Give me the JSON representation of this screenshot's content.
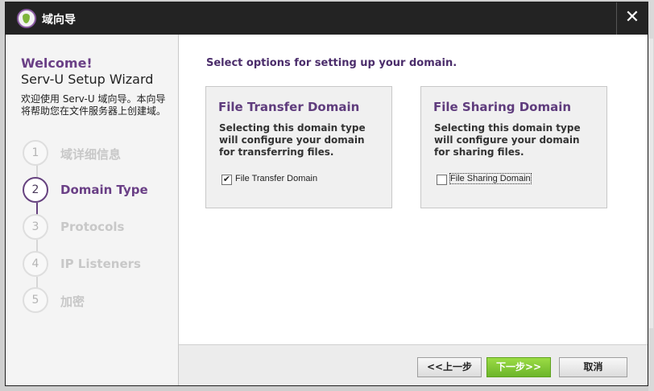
{
  "window": {
    "title": "域向导",
    "close_glyph": "✕"
  },
  "sidebar": {
    "welcome": "Welcome!",
    "subtitle": "Serv-U Setup Wizard",
    "description": "欢迎使用 Serv-U 域向导。本向导将帮助您在文件服务器上创建域。",
    "steps": [
      {
        "number": "1",
        "label": "域详细信息",
        "state": "done"
      },
      {
        "number": "2",
        "label": "Domain Type",
        "state": "active"
      },
      {
        "number": "3",
        "label": "Protocols",
        "state": "pending"
      },
      {
        "number": "4",
        "label": "IP Listeners",
        "state": "pending"
      },
      {
        "number": "5",
        "label": "加密",
        "state": "pending"
      }
    ]
  },
  "main": {
    "headline": "Select options for setting up your domain.",
    "cards": [
      {
        "title": "File Transfer Domain",
        "text": "Selecting this domain type will configure your domain for transferring files.",
        "checkbox_label": "File Transfer Domain",
        "checked": true
      },
      {
        "title": "File Sharing Domain",
        "text": "Selecting this domain type will configure your domain for sharing files.",
        "checkbox_label": "File Sharing Domain",
        "checked": false
      }
    ]
  },
  "footer": {
    "prev": "<<上一步",
    "next": "下一步>>",
    "cancel": "取消"
  },
  "colors": {
    "accent_purple": "#6a3f86",
    "next_green": "#7dc435",
    "titlebar": "#232323"
  },
  "icons": {
    "logo": "serv-u-logo-icon",
    "close": "close-icon",
    "check": "check-mark-icon"
  }
}
